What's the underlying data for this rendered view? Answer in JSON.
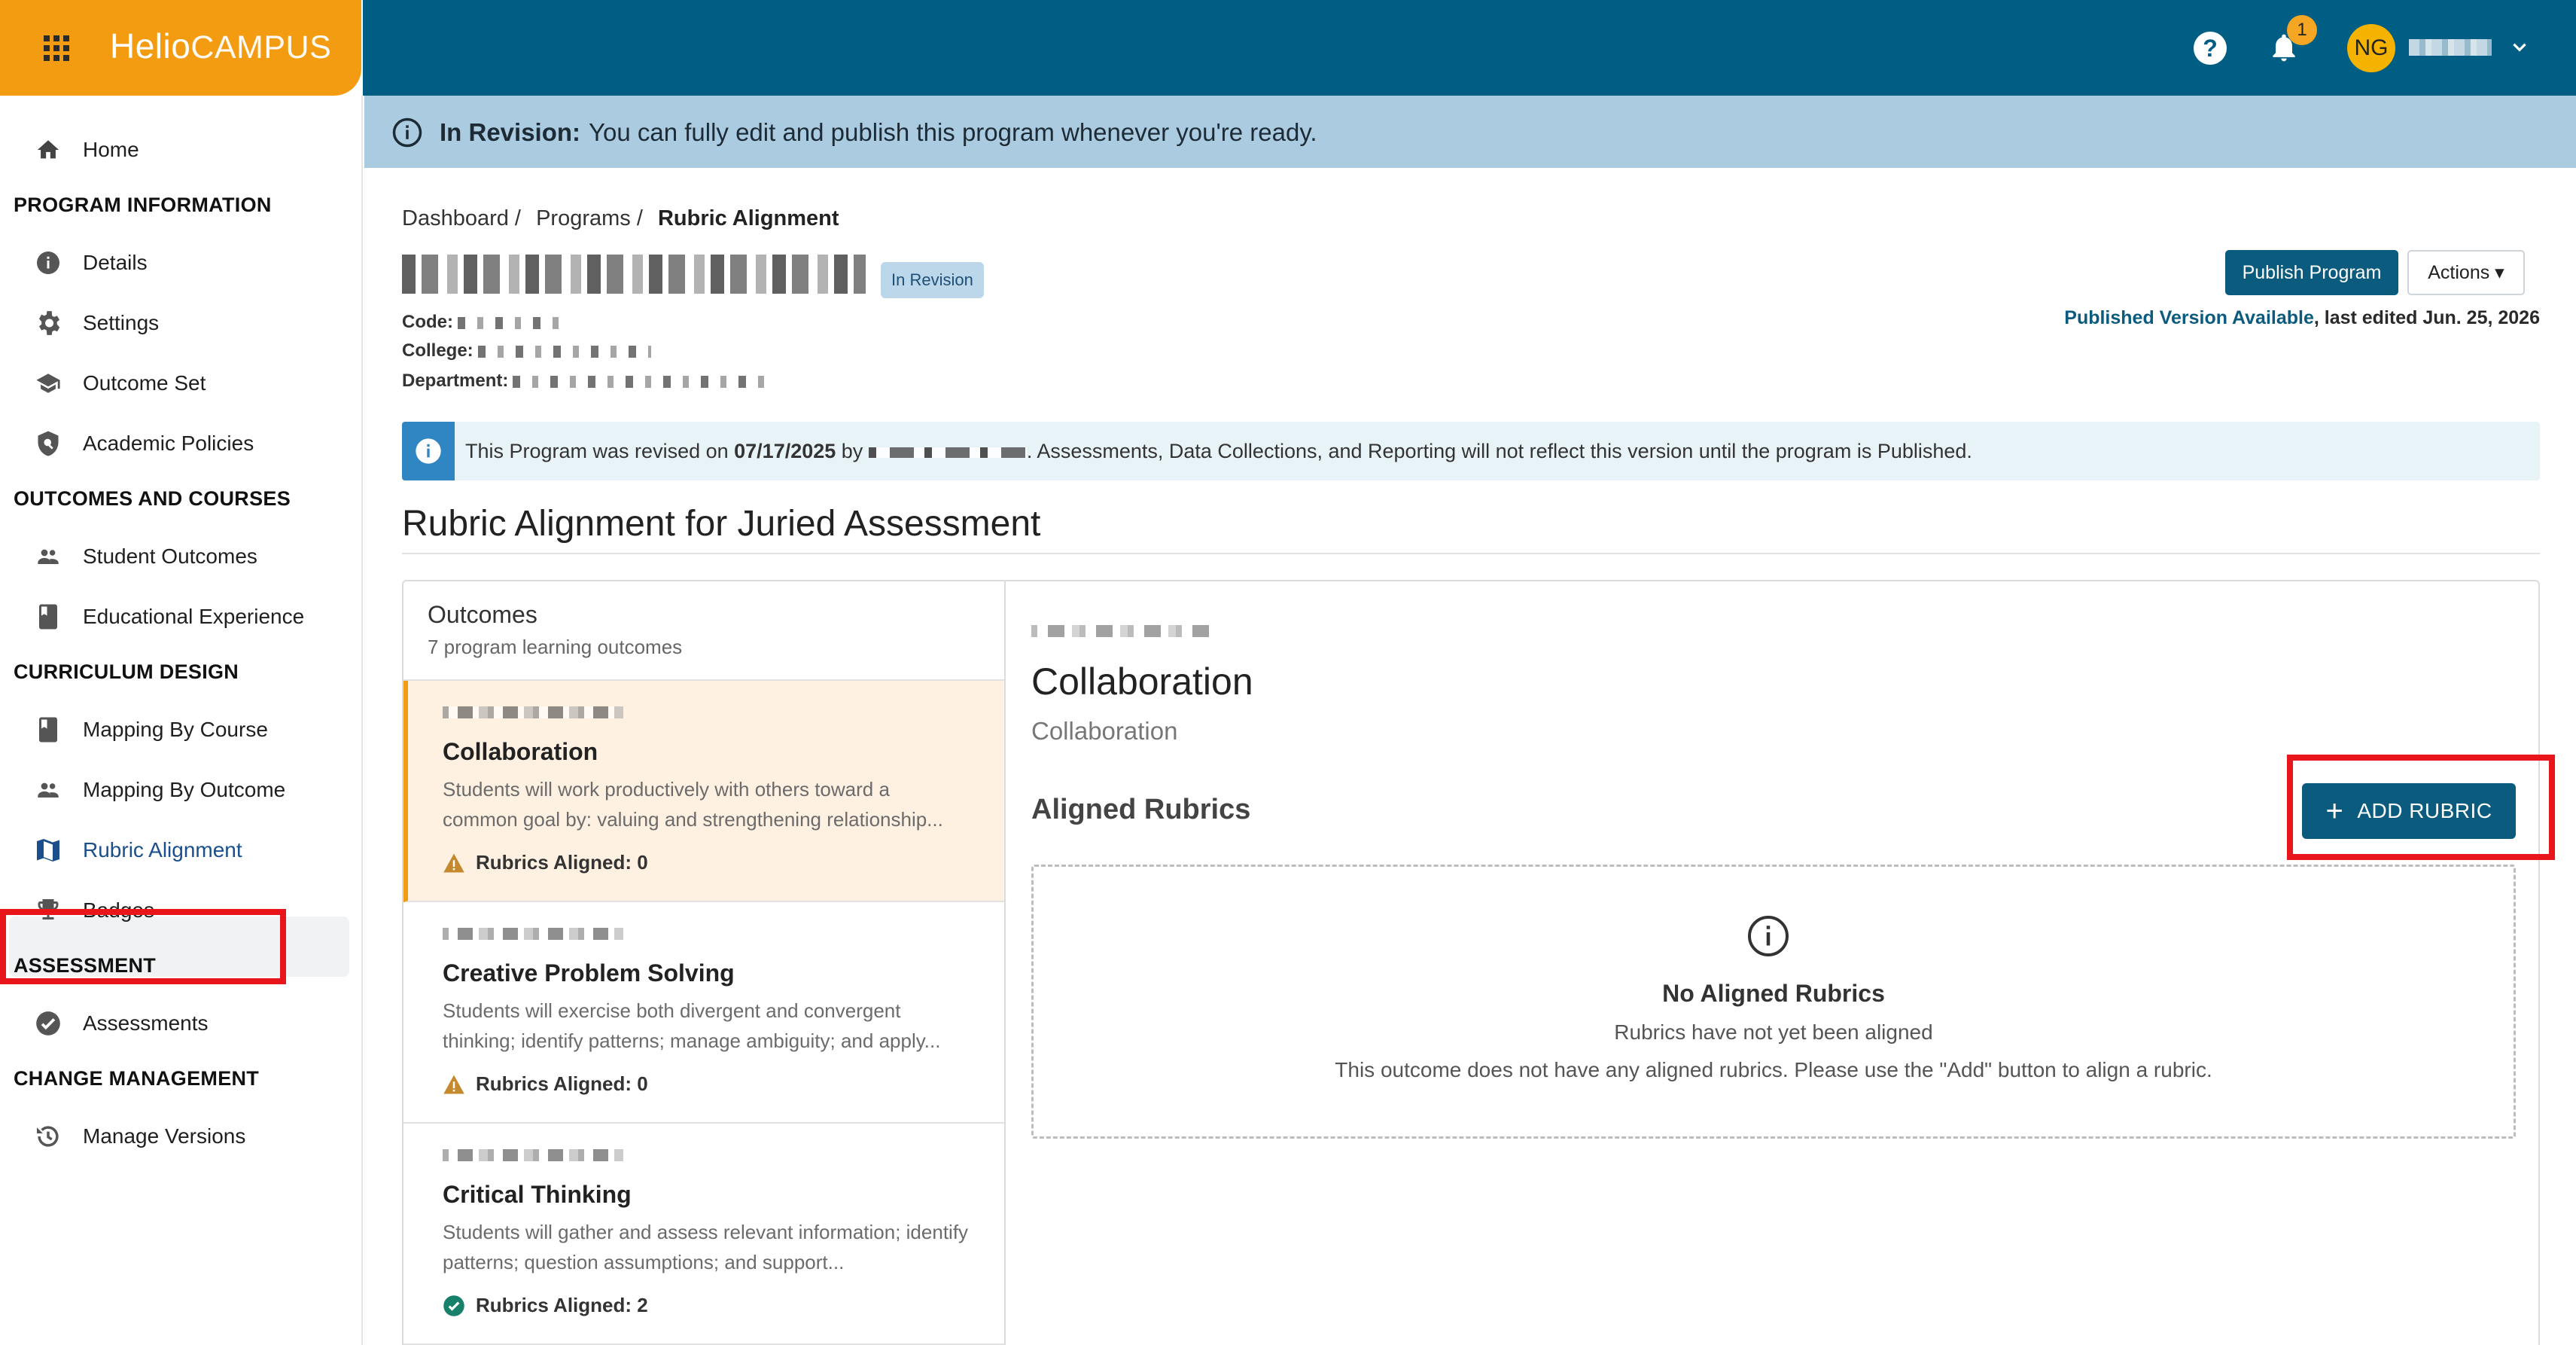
{
  "brand": {
    "name_bold": "Helio",
    "name_light": "CAMPUS"
  },
  "topbar": {
    "help_icon": "question-circle-icon",
    "bell_icon": "bell-icon",
    "notification_count": "1",
    "user_initials": "NG"
  },
  "revision_banner": {
    "title": "In Revision:",
    "message": "You can fully edit and publish this program whenever you're ready."
  },
  "sidebar": {
    "home": "Home",
    "sections": [
      {
        "title": "PROGRAM INFORMATION",
        "items": [
          "Details",
          "Settings",
          "Outcome Set",
          "Academic Policies"
        ]
      },
      {
        "title": "OUTCOMES AND COURSES",
        "items": [
          "Student Outcomes",
          "Educational Experience"
        ]
      },
      {
        "title": "CURRICULUM DESIGN",
        "items": [
          "Mapping By Course",
          "Mapping By Outcome",
          "Rubric Alignment",
          "Badges"
        ]
      },
      {
        "title": "ASSESSMENT",
        "items": [
          "Assessments"
        ]
      },
      {
        "title": "CHANGE MANAGEMENT",
        "items": [
          "Manage Versions"
        ]
      }
    ],
    "active_item": "Rubric Alignment"
  },
  "breadcrumb": [
    "Dashboard /",
    "Programs /",
    "Rubric Alignment"
  ],
  "program": {
    "status_pill": "In Revision",
    "code_label": "Code:",
    "college_label": "College:",
    "department_label": "Department:"
  },
  "actions": {
    "publish": "Publish Program",
    "actions": "Actions ▾",
    "published_link": "Published Version Available",
    "last_edited": ", last edited Jun. 25, 2026"
  },
  "info_bar": {
    "prefix": "This Program was revised on ",
    "date": "07/17/2025",
    "by": " by ",
    "suffix": ". Assessments, Data Collections, and Reporting will not reflect this version until the program is Published."
  },
  "section_title": "Rubric Alignment for Juried Assessment",
  "outcomes_panel": {
    "heading": "Outcomes",
    "subheading": "7 program learning outcomes",
    "items": [
      {
        "name": "Collaboration",
        "desc": "Students will work productively with others toward a common goal by: valuing and strengthening relationship...",
        "aligned_label": "Rubrics Aligned:",
        "aligned_count": "0",
        "status_icon": "warning-icon"
      },
      {
        "name": "Creative Problem Solving",
        "desc": "Students will exercise both divergent and convergent thinking; identify patterns; manage ambiguity; and apply...",
        "aligned_label": "Rubrics Aligned:",
        "aligned_count": "0",
        "status_icon": "warning-icon"
      },
      {
        "name": "Critical Thinking",
        "desc": "Students will gather and assess relevant information; identify patterns; question assumptions; and support...",
        "aligned_label": "Rubrics Aligned:",
        "aligned_count": "2",
        "status_icon": "check-circle-icon"
      }
    ]
  },
  "detail": {
    "title": "Collaboration",
    "subtitle": "Collaboration",
    "aligned_heading": "Aligned Rubrics",
    "add_button": "ADD RUBRIC",
    "empty_title": "No Aligned Rubrics",
    "empty_line1": "Rubrics have not yet been aligned",
    "empty_line2": "This outcome does not have any aligned rubrics. Please use the \"Add\" button to align a rubric."
  },
  "colors": {
    "brand_orange": "#f39c12",
    "topbar_blue": "#005d84",
    "banner_blue": "#aacbe0",
    "primary_button": "#0b5b7f",
    "highlight_red": "#e8151a",
    "active_outcome_bg": "#fef1e2"
  }
}
